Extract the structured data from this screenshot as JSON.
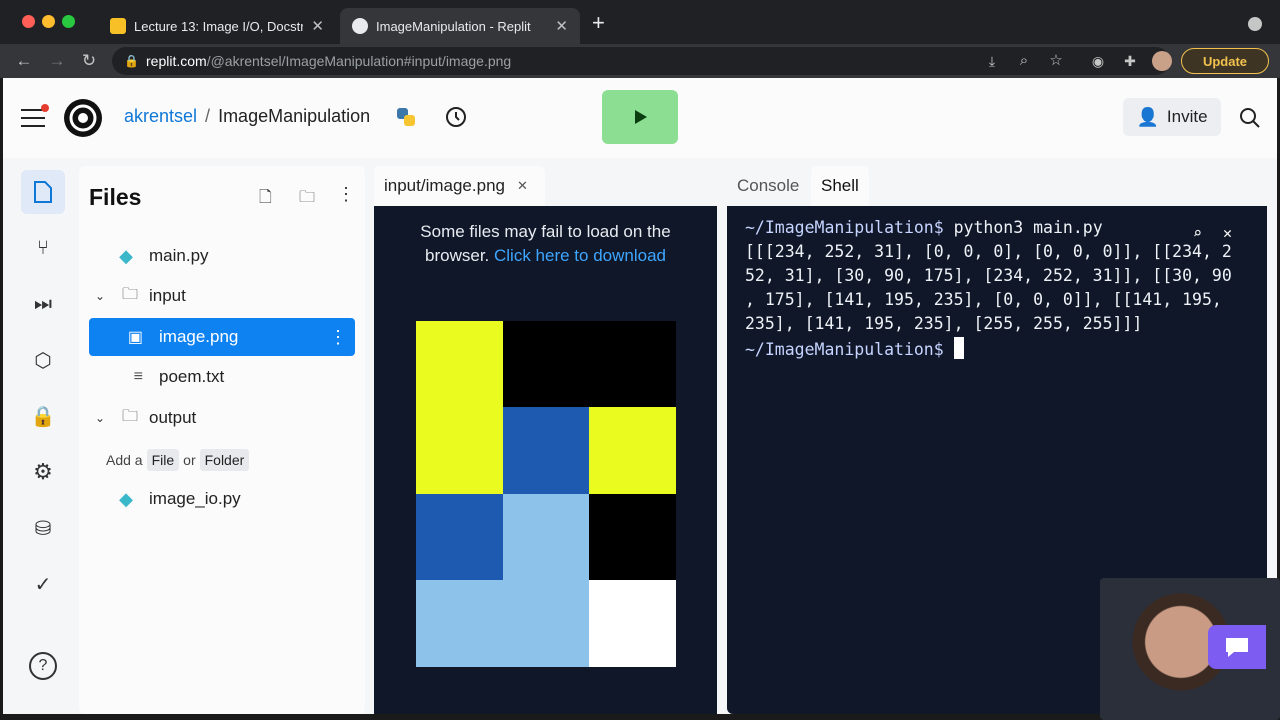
{
  "browser": {
    "tabs": [
      {
        "title": "Lecture 13: Image I/O, Docstrin",
        "active": false
      },
      {
        "title": "ImageManipulation - Replit",
        "active": true
      }
    ],
    "url_host": "replit.com",
    "url_path": "/@akrentsel/ImageManipulation#input/image.png",
    "update_label": "Update"
  },
  "header": {
    "user": "akrentsel",
    "separator": "/",
    "repl_name": "ImageManipulation",
    "invite_label": "Invite"
  },
  "files": {
    "title": "Files",
    "items": [
      {
        "name": "main.py",
        "type": "python"
      },
      {
        "name": "input",
        "type": "folder"
      },
      {
        "name": "image.png",
        "type": "image"
      },
      {
        "name": "poem.txt",
        "type": "text"
      },
      {
        "name": "output",
        "type": "folder"
      },
      {
        "name": "image_io.py",
        "type": "python"
      }
    ],
    "add_prefix": "Add a",
    "add_file": "File",
    "add_or": "or",
    "add_folder": "Folder"
  },
  "editor": {
    "tab_label": "input/image.png",
    "message": "Some files may fail to load on the browser.",
    "link": "Click here to download",
    "pixels": [
      [
        [
          234,
          252,
          31
        ],
        [
          0,
          0,
          0
        ],
        [
          0,
          0,
          0
        ]
      ],
      [
        [
          234,
          252,
          31
        ],
        [
          30,
          90,
          175
        ],
        [
          234,
          252,
          31
        ]
      ],
      [
        [
          30,
          90,
          175
        ],
        [
          141,
          195,
          235
        ],
        [
          0,
          0,
          0
        ]
      ],
      [
        [
          141,
          195,
          235
        ],
        [
          141,
          195,
          235
        ],
        [
          255,
          255,
          255
        ]
      ]
    ]
  },
  "console": {
    "tabs": [
      "Console",
      "Shell"
    ],
    "active_tab": "Shell",
    "prompt": "~/ImageManipulation$",
    "command": "python3 main.py",
    "output_lines": [
      "[[[234, 252, 31], [0, 0, 0], [0, 0, 0]], [[234, 2",
      "52, 31], [30, 90, 175], [234, 252, 31]], [[30, 90",
      ", 175], [141, 195, 235], [0, 0, 0]], [[141, 195,",
      "235], [141, 195, 235], [255, 255, 255]]]"
    ]
  }
}
